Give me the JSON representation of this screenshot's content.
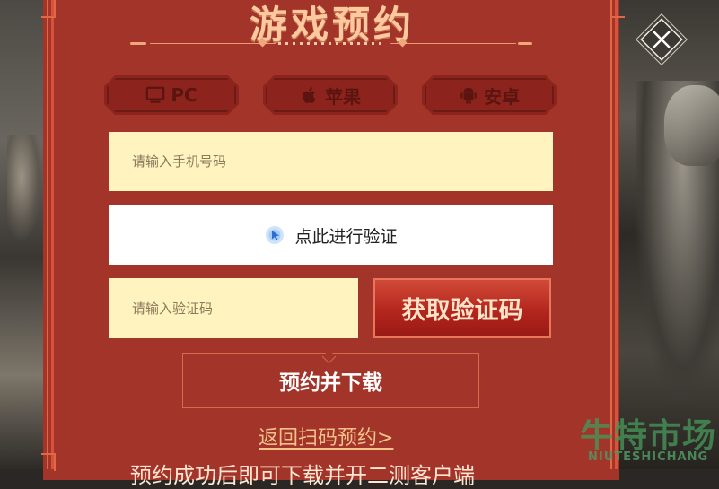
{
  "dialog": {
    "title": "游戏预约",
    "close_icon": "close-icon",
    "platform_tabs": [
      {
        "label": "PC",
        "icon": "monitor-icon"
      },
      {
        "label": "苹果",
        "icon": "apple-icon"
      },
      {
        "label": "安卓",
        "icon": "android-icon"
      }
    ],
    "phone_placeholder": "请输入手机号码",
    "verify_label": "点此进行验证",
    "verify_icon": "cursor-click-icon",
    "code_placeholder": "请输入验证码",
    "get_code_label": "获取验证码",
    "reserve_label": "预约并下载",
    "back_link_label": "返回扫码预约>",
    "bottom_text": "预约成功后即可下载并开二测客户端"
  },
  "watermark": {
    "text": "牛特市场",
    "subtext": "NIUTESHICHANG"
  },
  "colors": {
    "dialog_bg": "#a3342a",
    "input_bg": "#fff3bf",
    "accent_button": "#b3261d",
    "title": "#ffc9a0",
    "link": "#f2c28a"
  }
}
